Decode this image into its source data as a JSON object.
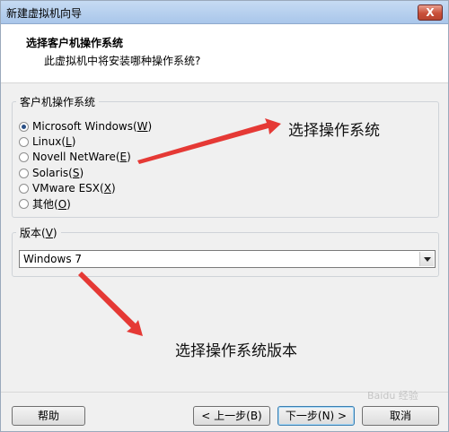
{
  "window": {
    "title": "新建虚拟机向导",
    "close_label": "X"
  },
  "header": {
    "title": "选择客户机操作系统",
    "subtitle": "此虚拟机中将安装哪种操作系统?"
  },
  "guest_os": {
    "group_label": "客户机操作系统",
    "options": [
      {
        "pre": "Microsoft Windows(",
        "key": "W",
        "post": ")",
        "checked": true
      },
      {
        "pre": "Linux(",
        "key": "L",
        "post": ")",
        "checked": false
      },
      {
        "pre": "Novell NetWare(",
        "key": "E",
        "post": ")",
        "checked": false
      },
      {
        "pre": "Solaris(",
        "key": "S",
        "post": ")",
        "checked": false
      },
      {
        "pre": "VMware ESX(",
        "key": "X",
        "post": ")",
        "checked": false
      },
      {
        "pre": "其他(",
        "key": "O",
        "post": ")",
        "checked": false
      }
    ]
  },
  "version": {
    "label_pre": "版本(",
    "label_key": "V",
    "label_post": ")",
    "selected": "Windows 7"
  },
  "annotations": {
    "os": "选择操作系统",
    "version": "选择操作系统版本"
  },
  "buttons": {
    "help": "帮助",
    "back": "< 上一步(B)",
    "next": "下一步(N) >",
    "cancel": "取消"
  },
  "watermark": "Baidu 经验",
  "colors": {
    "arrow": "#e53935",
    "titlebar": "#b9d1ee",
    "radio_dot": "#2a4f86"
  }
}
